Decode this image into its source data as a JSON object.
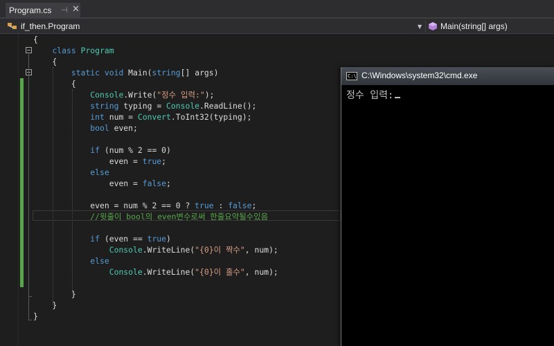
{
  "tab": {
    "title": "Program.cs"
  },
  "nav": {
    "class_path": "if_then.Program",
    "member": "Main(string[] args)"
  },
  "console": {
    "title": "C:\\Windows\\system32\\cmd.exe",
    "output": "정수 입력:"
  },
  "code_lines": [
    [
      {
        "t": "{",
        "c": "pl"
      }
    ],
    [
      {
        "t": "    ",
        "c": "pl"
      },
      {
        "t": "class",
        "c": "kw"
      },
      {
        "t": " ",
        "c": "pl"
      },
      {
        "t": "Program",
        "c": "ty"
      }
    ],
    [
      {
        "t": "    {",
        "c": "pl"
      }
    ],
    [
      {
        "t": "        ",
        "c": "pl"
      },
      {
        "t": "static",
        "c": "kw"
      },
      {
        "t": " ",
        "c": "pl"
      },
      {
        "t": "void",
        "c": "kw"
      },
      {
        "t": " Main(",
        "c": "pl"
      },
      {
        "t": "string",
        "c": "kw"
      },
      {
        "t": "[] args)",
        "c": "pl"
      }
    ],
    [
      {
        "t": "        {",
        "c": "pl"
      }
    ],
    [
      {
        "t": "            ",
        "c": "pl"
      },
      {
        "t": "Console",
        "c": "ty"
      },
      {
        "t": ".Write(",
        "c": "pl"
      },
      {
        "t": "\"정수 입력:\"",
        "c": "st"
      },
      {
        "t": ");",
        "c": "pl"
      }
    ],
    [
      {
        "t": "            ",
        "c": "pl"
      },
      {
        "t": "string",
        "c": "kw"
      },
      {
        "t": " typing = ",
        "c": "pl"
      },
      {
        "t": "Console",
        "c": "ty"
      },
      {
        "t": ".ReadLine();",
        "c": "pl"
      }
    ],
    [
      {
        "t": "            ",
        "c": "pl"
      },
      {
        "t": "int",
        "c": "kw"
      },
      {
        "t": " num = ",
        "c": "pl"
      },
      {
        "t": "Convert",
        "c": "ty"
      },
      {
        "t": ".ToInt32(typing);",
        "c": "pl"
      }
    ],
    [
      {
        "t": "            ",
        "c": "pl"
      },
      {
        "t": "bool",
        "c": "kw"
      },
      {
        "t": " even;",
        "c": "pl"
      }
    ],
    [
      {
        "t": "",
        "c": "pl"
      }
    ],
    [
      {
        "t": "            ",
        "c": "pl"
      },
      {
        "t": "if",
        "c": "kw"
      },
      {
        "t": " (num % 2 == 0)",
        "c": "pl"
      }
    ],
    [
      {
        "t": "                even = ",
        "c": "pl"
      },
      {
        "t": "true",
        "c": "kw"
      },
      {
        "t": ";",
        "c": "pl"
      }
    ],
    [
      {
        "t": "            ",
        "c": "pl"
      },
      {
        "t": "else",
        "c": "kw"
      }
    ],
    [
      {
        "t": "                even = ",
        "c": "pl"
      },
      {
        "t": "false",
        "c": "kw"
      },
      {
        "t": ";",
        "c": "pl"
      }
    ],
    [
      {
        "t": "",
        "c": "pl"
      }
    ],
    [
      {
        "t": "            even = num % 2 == 0 ? ",
        "c": "pl"
      },
      {
        "t": "true",
        "c": "kw"
      },
      {
        "t": " : ",
        "c": "pl"
      },
      {
        "t": "false",
        "c": "kw"
      },
      {
        "t": ";",
        "c": "pl"
      }
    ],
    [
      {
        "t": "            ",
        "c": "pl"
      },
      {
        "t": "//윗줄이 bool의 even변수로써 한줄요약될수있음",
        "c": "cm"
      }
    ],
    [
      {
        "t": "",
        "c": "pl"
      }
    ],
    [
      {
        "t": "            ",
        "c": "pl"
      },
      {
        "t": "if",
        "c": "kw"
      },
      {
        "t": " (even == ",
        "c": "pl"
      },
      {
        "t": "true",
        "c": "kw"
      },
      {
        "t": ")",
        "c": "pl"
      }
    ],
    [
      {
        "t": "                ",
        "c": "pl"
      },
      {
        "t": "Console",
        "c": "ty"
      },
      {
        "t": ".WriteLine(",
        "c": "pl"
      },
      {
        "t": "\"{0}이 짝수\"",
        "c": "st"
      },
      {
        "t": ", num);",
        "c": "pl"
      }
    ],
    [
      {
        "t": "            ",
        "c": "pl"
      },
      {
        "t": "else",
        "c": "kw"
      }
    ],
    [
      {
        "t": "                ",
        "c": "pl"
      },
      {
        "t": "Console",
        "c": "ty"
      },
      {
        "t": ".WriteLine(",
        "c": "pl"
      },
      {
        "t": "\"{0}이 홀수\"",
        "c": "st"
      },
      {
        "t": ", num);",
        "c": "pl"
      }
    ],
    [
      {
        "t": "",
        "c": "pl"
      }
    ],
    [
      {
        "t": "        }",
        "c": "pl"
      }
    ],
    [
      {
        "t": "    }",
        "c": "pl"
      }
    ],
    [
      {
        "t": "}",
        "c": "pl"
      }
    ]
  ]
}
